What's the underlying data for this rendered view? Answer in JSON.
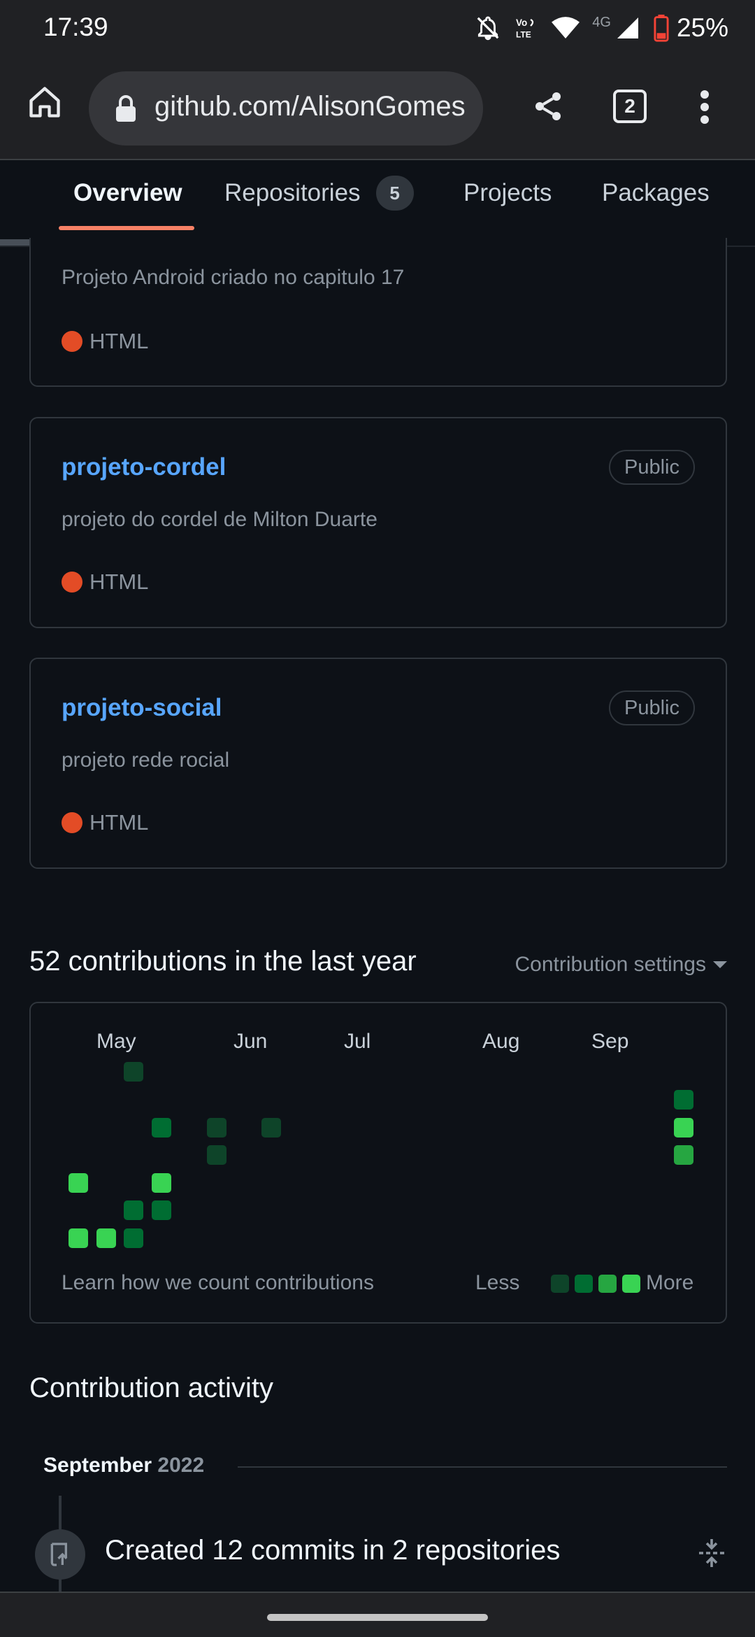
{
  "status_bar": {
    "time": "17:39",
    "network_label": "4G",
    "volte_label": "Vo LTE",
    "battery_percent": "25%"
  },
  "browser": {
    "url": "github.com/AlisonGomes",
    "tab_count": "2"
  },
  "profile_tabs": [
    {
      "label": "Overview",
      "active": true
    },
    {
      "label": "Repositories",
      "counter": "5"
    },
    {
      "label": "Projects"
    },
    {
      "label": "Packages"
    }
  ],
  "repos": [
    {
      "name": "",
      "description": "Projeto Android criado no capitulo 17",
      "language": "HTML",
      "language_color": "#e34c26"
    },
    {
      "name": "projeto-cordel",
      "badge": "Public",
      "description": "projeto do cordel de Milton Duarte",
      "language": "HTML",
      "language_color": "#e34c26"
    },
    {
      "name": "projeto-social",
      "badge": "Public",
      "description": "projeto rede rocial",
      "language": "HTML",
      "language_color": "#e34c26"
    }
  ],
  "contributions": {
    "title": "52 contributions in the last year",
    "settings_label": "Contribution settings",
    "months": [
      "May",
      "Jun",
      "Jul",
      "Aug",
      "Sep"
    ],
    "learn_link": "Learn how we count contributions",
    "legend_less": "Less",
    "legend_more": "More",
    "level_colors": [
      "#0e4429",
      "#006d32",
      "#26a641",
      "#39d353"
    ]
  },
  "activity": {
    "title": "Contribution activity",
    "month": "September",
    "year": "2022",
    "item_text": "Created 12 commits in 2 repositories"
  }
}
